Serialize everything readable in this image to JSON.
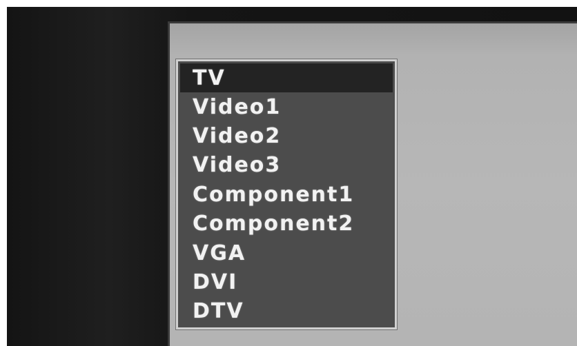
{
  "source_menu": {
    "items": [
      {
        "label": "TV",
        "selected": true
      },
      {
        "label": "Video1",
        "selected": false
      },
      {
        "label": "Video2",
        "selected": false
      },
      {
        "label": "Video3",
        "selected": false
      },
      {
        "label": "Component1",
        "selected": false
      },
      {
        "label": "Component2",
        "selected": false
      },
      {
        "label": "VGA",
        "selected": false
      },
      {
        "label": "DVI",
        "selected": false
      },
      {
        "label": "DTV",
        "selected": false
      }
    ]
  },
  "colors": {
    "menu_background": "#4c4c4c",
    "selected_row": "#232323",
    "menu_border": "#d0d0d0",
    "screen": "#b6b6b6",
    "bezel": "#151515",
    "text": "#f2f2f2"
  }
}
